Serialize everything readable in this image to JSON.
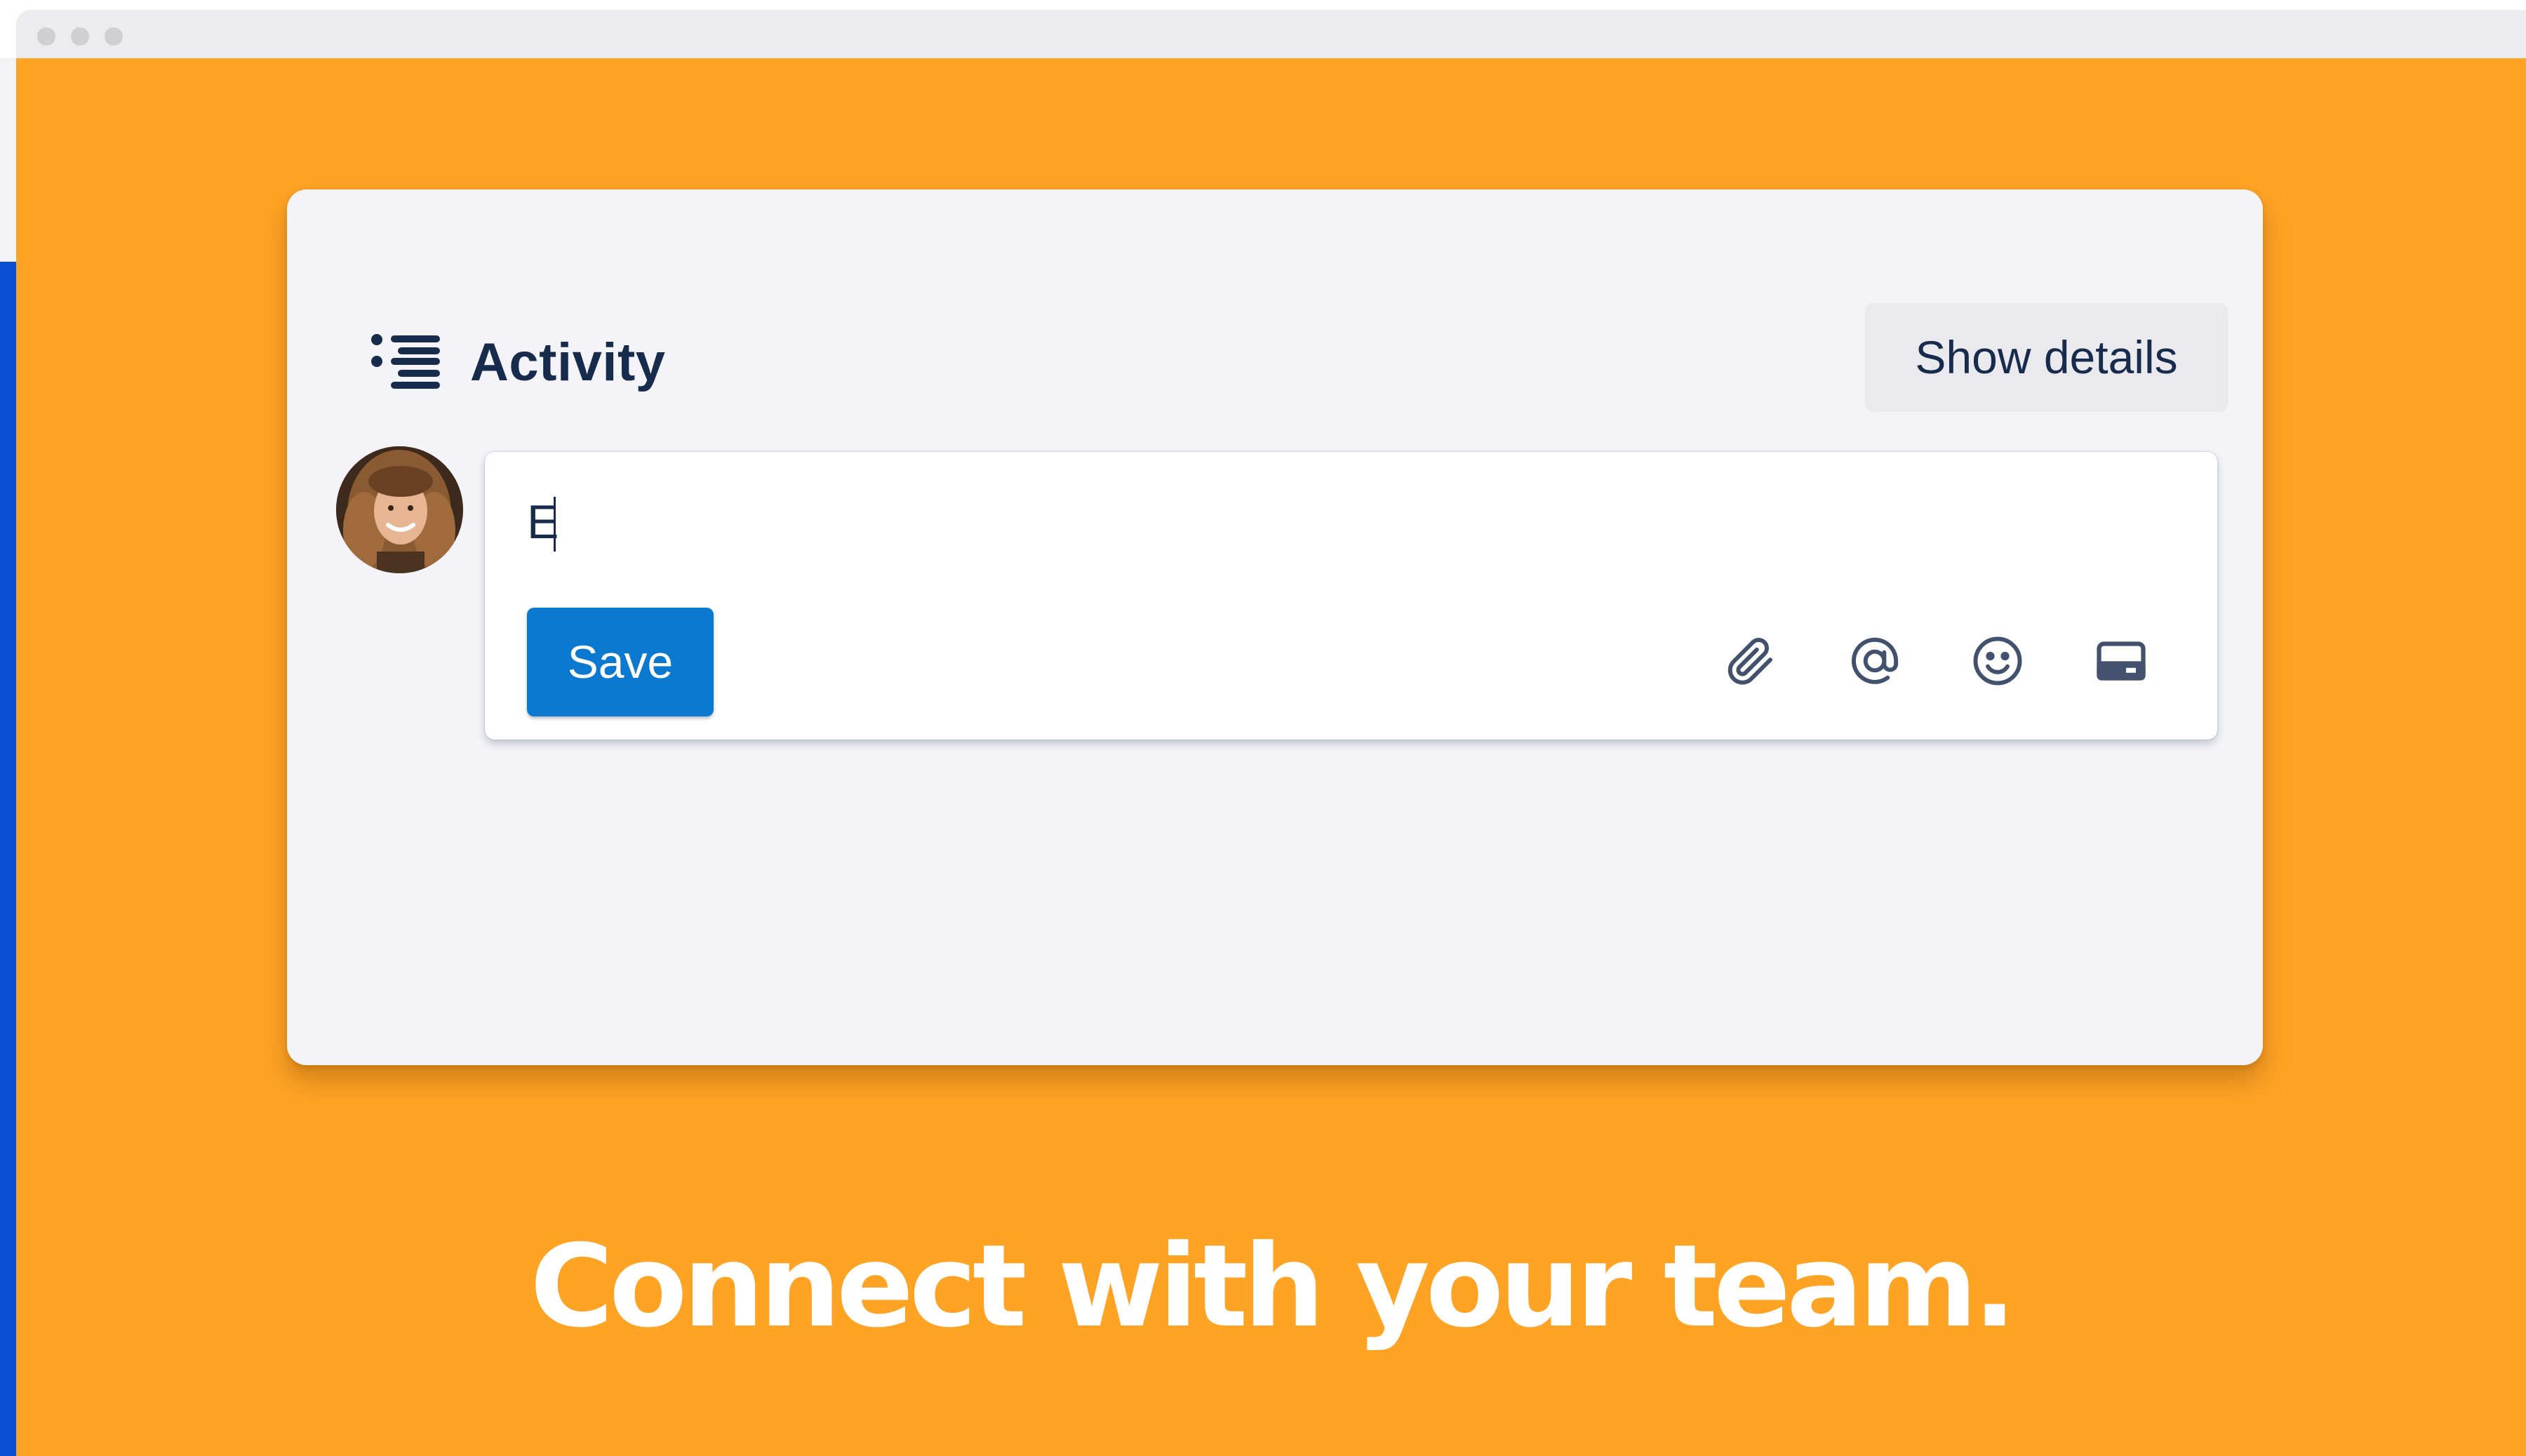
{
  "window": {
    "dots_count": 3
  },
  "activity": {
    "title": "Activity",
    "show_details_label": "Show details",
    "icon": "activity-list-icon"
  },
  "comment": {
    "value": "E",
    "avatar": "user-avatar",
    "save_label": "Save",
    "toolbar_icons": [
      "paperclip-icon",
      "mention-icon",
      "emoji-icon",
      "card-icon"
    ]
  },
  "headline": "Connect with your team.",
  "colors": {
    "background": "#ffa325",
    "card": "#f4f4f8",
    "save_button": "#0b79cf",
    "title_text": "#172b4d",
    "edge_strip": "#0b4fd6"
  }
}
